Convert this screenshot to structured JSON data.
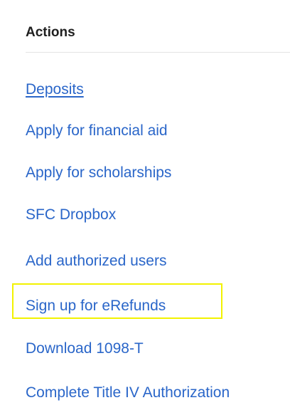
{
  "actions": {
    "heading": "Actions",
    "items": [
      {
        "label": "Deposits"
      },
      {
        "label": "Apply for financial aid"
      },
      {
        "label": "Apply for scholarships"
      },
      {
        "label": "SFC Dropbox"
      },
      {
        "label": "Add authorized users"
      },
      {
        "label": "Sign up for eRefunds"
      },
      {
        "label": "Download 1098-T"
      },
      {
        "label": "Complete Title IV Authorization"
      }
    ]
  },
  "colors": {
    "link": "#2a66c9",
    "heading": "#1f1f1f",
    "highlight": "#f2f200"
  }
}
